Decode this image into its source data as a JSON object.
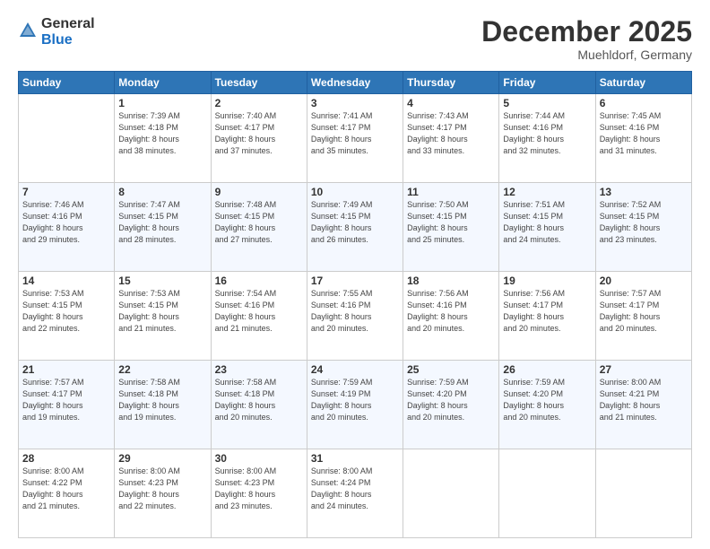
{
  "logo": {
    "general": "General",
    "blue": "Blue"
  },
  "header": {
    "month": "December 2025",
    "location": "Muehldorf, Germany"
  },
  "weekdays": [
    "Sunday",
    "Monday",
    "Tuesday",
    "Wednesday",
    "Thursday",
    "Friday",
    "Saturday"
  ],
  "weeks": [
    [
      {
        "day": "",
        "info": ""
      },
      {
        "day": "1",
        "info": "Sunrise: 7:39 AM\nSunset: 4:18 PM\nDaylight: 8 hours\nand 38 minutes."
      },
      {
        "day": "2",
        "info": "Sunrise: 7:40 AM\nSunset: 4:17 PM\nDaylight: 8 hours\nand 37 minutes."
      },
      {
        "day": "3",
        "info": "Sunrise: 7:41 AM\nSunset: 4:17 PM\nDaylight: 8 hours\nand 35 minutes."
      },
      {
        "day": "4",
        "info": "Sunrise: 7:43 AM\nSunset: 4:17 PM\nDaylight: 8 hours\nand 33 minutes."
      },
      {
        "day": "5",
        "info": "Sunrise: 7:44 AM\nSunset: 4:16 PM\nDaylight: 8 hours\nand 32 minutes."
      },
      {
        "day": "6",
        "info": "Sunrise: 7:45 AM\nSunset: 4:16 PM\nDaylight: 8 hours\nand 31 minutes."
      }
    ],
    [
      {
        "day": "7",
        "info": "Sunrise: 7:46 AM\nSunset: 4:16 PM\nDaylight: 8 hours\nand 29 minutes."
      },
      {
        "day": "8",
        "info": "Sunrise: 7:47 AM\nSunset: 4:15 PM\nDaylight: 8 hours\nand 28 minutes."
      },
      {
        "day": "9",
        "info": "Sunrise: 7:48 AM\nSunset: 4:15 PM\nDaylight: 8 hours\nand 27 minutes."
      },
      {
        "day": "10",
        "info": "Sunrise: 7:49 AM\nSunset: 4:15 PM\nDaylight: 8 hours\nand 26 minutes."
      },
      {
        "day": "11",
        "info": "Sunrise: 7:50 AM\nSunset: 4:15 PM\nDaylight: 8 hours\nand 25 minutes."
      },
      {
        "day": "12",
        "info": "Sunrise: 7:51 AM\nSunset: 4:15 PM\nDaylight: 8 hours\nand 24 minutes."
      },
      {
        "day": "13",
        "info": "Sunrise: 7:52 AM\nSunset: 4:15 PM\nDaylight: 8 hours\nand 23 minutes."
      }
    ],
    [
      {
        "day": "14",
        "info": "Sunrise: 7:53 AM\nSunset: 4:15 PM\nDaylight: 8 hours\nand 22 minutes."
      },
      {
        "day": "15",
        "info": "Sunrise: 7:53 AM\nSunset: 4:15 PM\nDaylight: 8 hours\nand 21 minutes."
      },
      {
        "day": "16",
        "info": "Sunrise: 7:54 AM\nSunset: 4:16 PM\nDaylight: 8 hours\nand 21 minutes."
      },
      {
        "day": "17",
        "info": "Sunrise: 7:55 AM\nSunset: 4:16 PM\nDaylight: 8 hours\nand 20 minutes."
      },
      {
        "day": "18",
        "info": "Sunrise: 7:56 AM\nSunset: 4:16 PM\nDaylight: 8 hours\nand 20 minutes."
      },
      {
        "day": "19",
        "info": "Sunrise: 7:56 AM\nSunset: 4:17 PM\nDaylight: 8 hours\nand 20 minutes."
      },
      {
        "day": "20",
        "info": "Sunrise: 7:57 AM\nSunset: 4:17 PM\nDaylight: 8 hours\nand 20 minutes."
      }
    ],
    [
      {
        "day": "21",
        "info": "Sunrise: 7:57 AM\nSunset: 4:17 PM\nDaylight: 8 hours\nand 19 minutes."
      },
      {
        "day": "22",
        "info": "Sunrise: 7:58 AM\nSunset: 4:18 PM\nDaylight: 8 hours\nand 19 minutes."
      },
      {
        "day": "23",
        "info": "Sunrise: 7:58 AM\nSunset: 4:18 PM\nDaylight: 8 hours\nand 20 minutes."
      },
      {
        "day": "24",
        "info": "Sunrise: 7:59 AM\nSunset: 4:19 PM\nDaylight: 8 hours\nand 20 minutes."
      },
      {
        "day": "25",
        "info": "Sunrise: 7:59 AM\nSunset: 4:20 PM\nDaylight: 8 hours\nand 20 minutes."
      },
      {
        "day": "26",
        "info": "Sunrise: 7:59 AM\nSunset: 4:20 PM\nDaylight: 8 hours\nand 20 minutes."
      },
      {
        "day": "27",
        "info": "Sunrise: 8:00 AM\nSunset: 4:21 PM\nDaylight: 8 hours\nand 21 minutes."
      }
    ],
    [
      {
        "day": "28",
        "info": "Sunrise: 8:00 AM\nSunset: 4:22 PM\nDaylight: 8 hours\nand 21 minutes."
      },
      {
        "day": "29",
        "info": "Sunrise: 8:00 AM\nSunset: 4:23 PM\nDaylight: 8 hours\nand 22 minutes."
      },
      {
        "day": "30",
        "info": "Sunrise: 8:00 AM\nSunset: 4:23 PM\nDaylight: 8 hours\nand 23 minutes."
      },
      {
        "day": "31",
        "info": "Sunrise: 8:00 AM\nSunset: 4:24 PM\nDaylight: 8 hours\nand 24 minutes."
      },
      {
        "day": "",
        "info": ""
      },
      {
        "day": "",
        "info": ""
      },
      {
        "day": "",
        "info": ""
      }
    ]
  ]
}
